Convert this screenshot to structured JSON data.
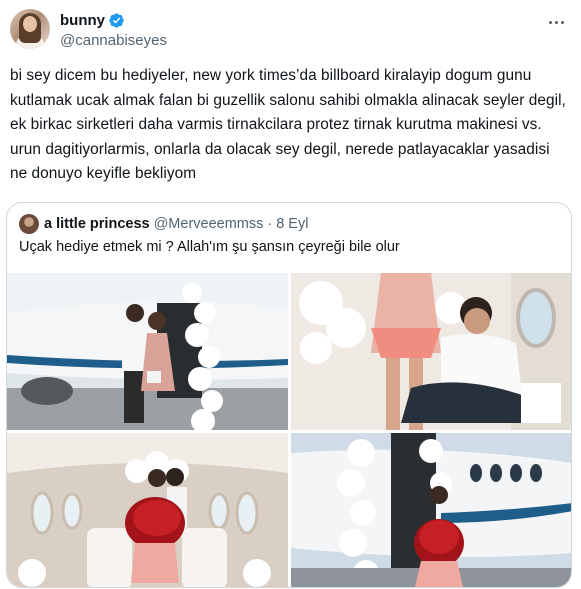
{
  "tweet": {
    "author": {
      "display_name": "bunny",
      "handle": "@cannabiseyes",
      "verified": true
    },
    "text": "bi sey dicem bu hediyeler, new york times’da billboard kiralayip dogum gunu kutlamak ucak almak falan bi guzellik salonu sahibi olmakla alinacak seyler degil, ek birkac sirketleri daha varmis tirnakcilara protez tirnak kurutma makinesi vs. urun dagitiyorlarmis, onlarla da olacak sey degil, nerede patlayacaklar yasadisi ne donuyo keyifle bekliyom",
    "more_icon": "more-horizontal-icon",
    "verified_badge_color": "#1d9bf0"
  },
  "quoted_tweet": {
    "author": {
      "display_name": "a little princess",
      "handle": "@Merveeemmss",
      "separator": "·",
      "date": "8 Eyl"
    },
    "text": "Uçak hediye etmek mi ? Allah'ım  şu şansın çeyreği bile olur",
    "media": [
      {
        "label": "couple-by-private-jet-photo"
      },
      {
        "label": "couple-seated-in-jet-photo"
      },
      {
        "label": "woman-with-roses-in-cabin-photo"
      },
      {
        "label": "woman-with-roses-at-jet-door-photo"
      }
    ]
  },
  "colors": {
    "text_primary": "#0f1419",
    "text_secondary": "#536471",
    "border": "#cfd9de"
  }
}
